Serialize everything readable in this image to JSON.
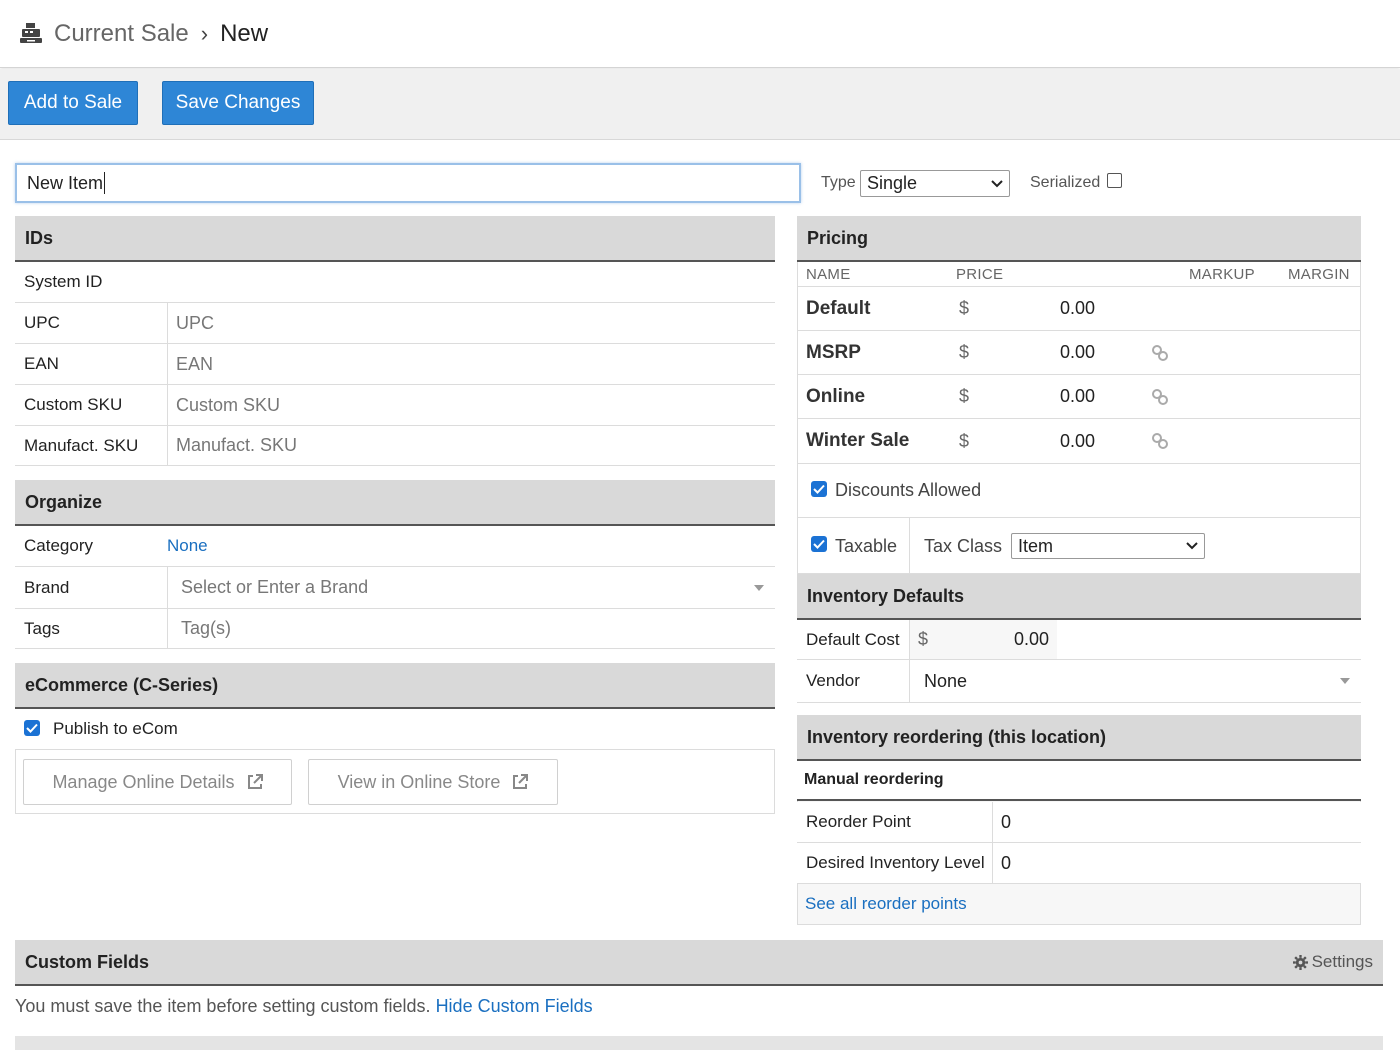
{
  "breadcrumb": {
    "current": "Current Sale",
    "separator": "›",
    "page": "New"
  },
  "toolbar": {
    "add_to_sale": "Add to Sale",
    "save_changes": "Save Changes"
  },
  "item": {
    "name_value": "New Item",
    "type_label": "Type",
    "type_value": "Single",
    "serialized_label": "Serialized",
    "serialized_checked": false
  },
  "ids": {
    "title": "IDs",
    "system_id_label": "System ID",
    "upc_label": "UPC",
    "upc_placeholder": "UPC",
    "ean_label": "EAN",
    "ean_placeholder": "EAN",
    "custom_sku_label": "Custom SKU",
    "custom_sku_placeholder": "Custom SKU",
    "manufact_sku_label": "Manufact. SKU",
    "manufact_sku_placeholder": "Manufact. SKU"
  },
  "organize": {
    "title": "Organize",
    "category_label": "Category",
    "category_value": "None",
    "brand_label": "Brand",
    "brand_placeholder": "Select or Enter a Brand",
    "tags_label": "Tags",
    "tags_placeholder": "Tag(s)"
  },
  "ecommerce": {
    "title": "eCommerce (C-Series)",
    "publish_label": "Publish to eCom",
    "publish_checked": true,
    "manage_button": "Manage Online Details",
    "view_button": "View in Online Store"
  },
  "pricing": {
    "title": "Pricing",
    "col_name": "NAME",
    "col_price": "PRICE",
    "col_markup": "MARKUP",
    "col_margin": "MARGIN",
    "currency": "$",
    "rows": [
      {
        "name": "Default",
        "price": "0.00",
        "linked": false
      },
      {
        "name": "MSRP",
        "price": "0.00",
        "linked": true
      },
      {
        "name": "Online",
        "price": "0.00",
        "linked": true
      },
      {
        "name": "Winter Sale",
        "price": "0.00",
        "linked": true
      }
    ],
    "discounts_label": "Discounts Allowed",
    "discounts_checked": true,
    "taxable_label": "Taxable",
    "taxable_checked": true,
    "tax_class_label": "Tax Class",
    "tax_class_value": "Item"
  },
  "inventory_defaults": {
    "title": "Inventory Defaults",
    "default_cost_label": "Default Cost",
    "currency": "$",
    "default_cost_value": "0.00",
    "vendor_label": "Vendor",
    "vendor_value": "None"
  },
  "reordering": {
    "title": "Inventory reordering (this location)",
    "subtitle": "Manual reordering",
    "reorder_point_label": "Reorder Point",
    "reorder_point_value": "0",
    "desired_level_label": "Desired Inventory Level",
    "desired_level_value": "0",
    "see_all_link": "See all reorder points"
  },
  "custom_fields": {
    "title": "Custom Fields",
    "settings_label": "Settings",
    "message": "You must save the item before setting custom fields.",
    "hide_link": "Hide Custom Fields"
  },
  "colors": {
    "accent": "#2e86d6",
    "link": "#1a6fc0",
    "checkbox": "#1b72d4",
    "section_bg": "#d9d9d9"
  }
}
